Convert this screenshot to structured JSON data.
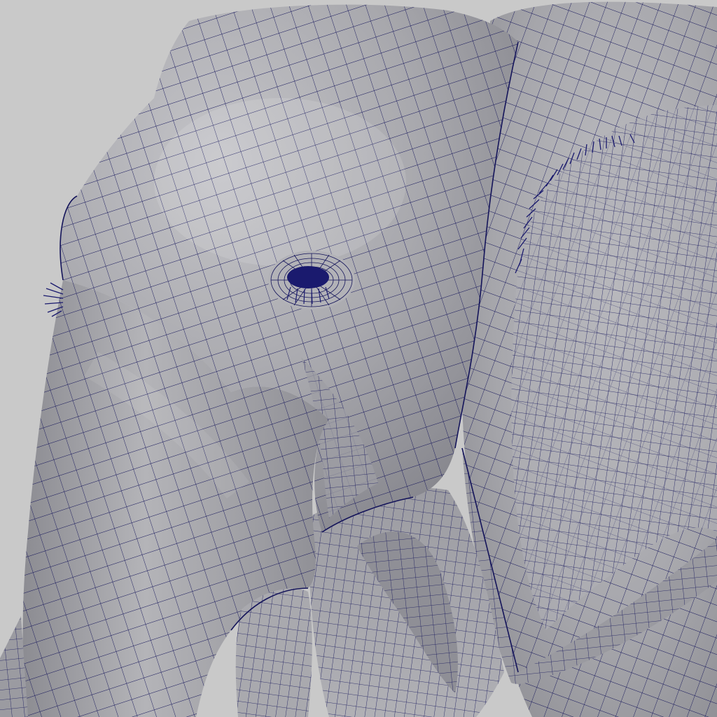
{
  "viewport": {
    "background_color": "#c9c9c9",
    "shading_mode": "wireframe-on-shaded",
    "wire_color": "#14145a",
    "surface_light": "#b8b8bc",
    "surface_mid": "#a3a3a8",
    "surface_dark": "#7f7f86",
    "eyelash_color": "#1a1a6e"
  },
  "model": {
    "subject": "elephant-head",
    "icon": "polygon-mesh-icon"
  }
}
